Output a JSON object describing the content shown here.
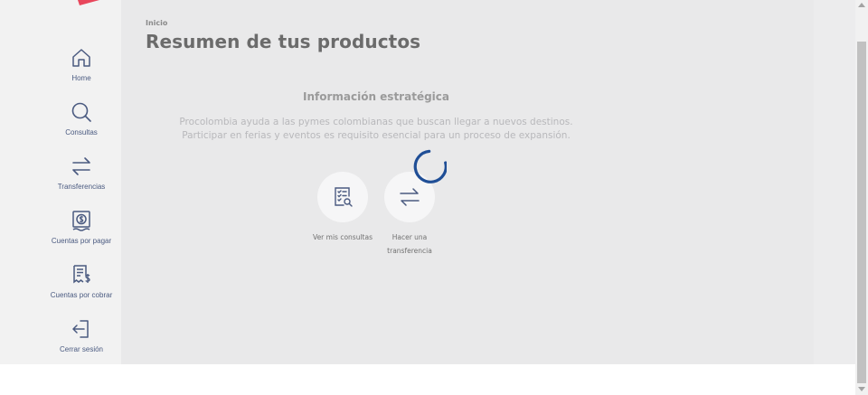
{
  "sidebar": {
    "items": [
      {
        "label": "Home",
        "icon": "home-icon"
      },
      {
        "label": "Consultas",
        "icon": "search-icon"
      },
      {
        "label": "Transferencias",
        "icon": "transfer-arrows-icon"
      },
      {
        "label": "Cuentas por pagar",
        "icon": "payable-bill-icon"
      },
      {
        "label": "Cuentas por cobrar",
        "icon": "receivable-invoice-icon"
      },
      {
        "label": "Cerrar sesión",
        "icon": "logout-icon"
      }
    ]
  },
  "header": {
    "breadcrumb": "Inicio",
    "title": "Resumen de tus productos"
  },
  "info": {
    "title": "Información estratégica",
    "line1": "Procolombia ayuda a las pymes colombianas que buscan llegar a nuevos destinos.",
    "line2": "Participar en ferias y eventos es requisito esencial para un proceso de expansión."
  },
  "quick_actions": [
    {
      "label": "Ver mis consultas",
      "icon": "consult-document-icon"
    },
    {
      "label_line1": "Hacer una",
      "label_line2": "transferencia",
      "icon": "transfer-arrows-icon"
    }
  ],
  "colors": {
    "nav_icon": "#4a5a80",
    "spinner": "#1f4e96",
    "logo_red": "#e8465b",
    "logo_yellow": "#f5c842"
  }
}
